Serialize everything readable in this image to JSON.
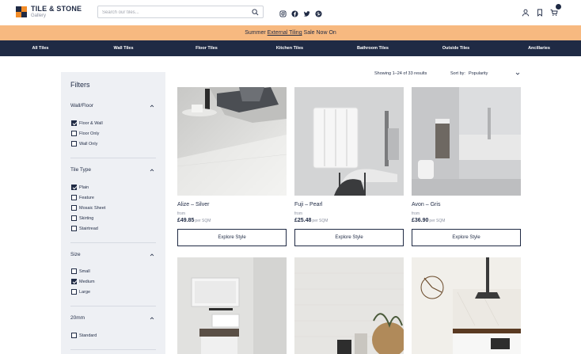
{
  "brand": {
    "name": "TILE & STONE",
    "sub": "Gallery"
  },
  "search": {
    "placeholder": "Search our tiles..."
  },
  "promo": {
    "before": "Summer ",
    "link": "External Tiling",
    "after": " Sale Now On"
  },
  "nav": {
    "items": [
      "All Tiles",
      "Wall Tiles",
      "Floor Tiles",
      "Kitchen Tiles",
      "Bathroom Tiles",
      "Outside Tiles",
      "Ancillaries"
    ]
  },
  "sidebar": {
    "title": "Filters",
    "groups": [
      {
        "title": "Wall/Floor",
        "options": [
          {
            "label": "Floor & Wall",
            "checked": true
          },
          {
            "label": "Floor Only",
            "checked": false
          },
          {
            "label": "Wall Only",
            "checked": false
          }
        ]
      },
      {
        "title": "Tile Type",
        "options": [
          {
            "label": "Plain",
            "checked": true
          },
          {
            "label": "Feature",
            "checked": false
          },
          {
            "label": "Mosaic Sheet",
            "checked": false
          },
          {
            "label": "Skirting",
            "checked": false
          },
          {
            "label": "Stairtread",
            "checked": false
          }
        ]
      },
      {
        "title": "Size",
        "options": [
          {
            "label": "Small",
            "checked": false
          },
          {
            "label": "Medium",
            "checked": true
          },
          {
            "label": "Large",
            "checked": false
          }
        ]
      },
      {
        "title": "20mm",
        "options": [
          {
            "label": "Standard",
            "checked": false
          }
        ]
      }
    ]
  },
  "results": {
    "count_text": "Showing 1–24 of 33 results",
    "sort_label": "Sort by:",
    "sort_value": "Popularity"
  },
  "products": [
    {
      "name": "Alize – Silver",
      "from": "from",
      "price": "£49.85",
      "unit": "per SQM",
      "button": "Explore Style"
    },
    {
      "name": "Fuji – Pearl",
      "from": "from",
      "price": "£25.48",
      "unit": "per SQM",
      "button": "Explore Style"
    },
    {
      "name": "Avon – Gris",
      "from": "from",
      "price": "£36.90",
      "unit": "per SQM",
      "button": "Explore Style"
    },
    {
      "name": "",
      "from": "",
      "price": "",
      "unit": "",
      "button": ""
    },
    {
      "name": "",
      "from": "",
      "price": "",
      "unit": "",
      "button": ""
    },
    {
      "name": "",
      "from": "",
      "price": "",
      "unit": "",
      "button": ""
    }
  ],
  "colors": {
    "navy": "#1f2a44",
    "orange": "#f28c28",
    "promo_bg": "#f7b980",
    "sidebar_bg": "#eef0f4"
  }
}
